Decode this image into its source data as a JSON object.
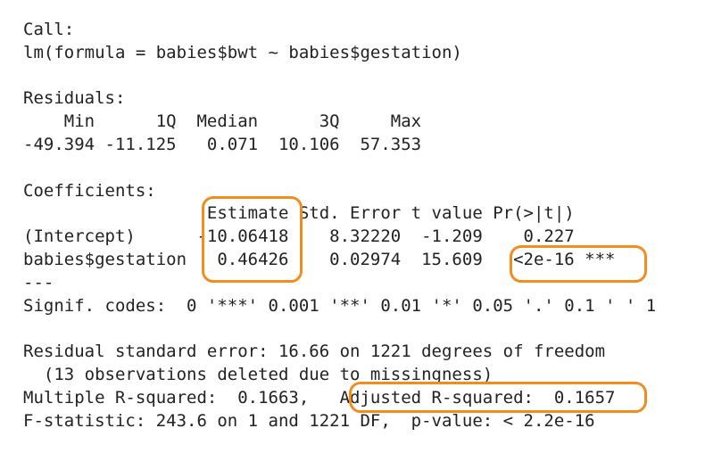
{
  "output": {
    "lines": [
      "Call:",
      "lm(formula = babies$bwt ~ babies$gestation)",
      "",
      "Residuals:",
      "    Min      1Q  Median      3Q     Max ",
      "-49.394 -11.125   0.071  10.106  57.353 ",
      "",
      "Coefficients:",
      "                  Estimate Std. Error t value Pr(>|t|)    ",
      "(Intercept)      -10.06418    8.32220  -1.209    0.227    ",
      "babies$gestation   0.46426    0.02974  15.609   <2e-16 ***",
      "---",
      "Signif. codes:  0 '***' 0.001 '**' 0.01 '*' 0.05 '.' 0.1 ' ' 1",
      "",
      "Residual standard error: 16.66 on 1221 degrees of freedom",
      "  (13 observations deleted due to missingness)",
      "Multiple R-squared:  0.1663,   Adjusted R-squared:  0.1657 ",
      "F-statistic: 243.6 on 1 and 1221 DF,  p-value: < 2.2e-16"
    ]
  },
  "highlight_color": "#f28c1f"
}
